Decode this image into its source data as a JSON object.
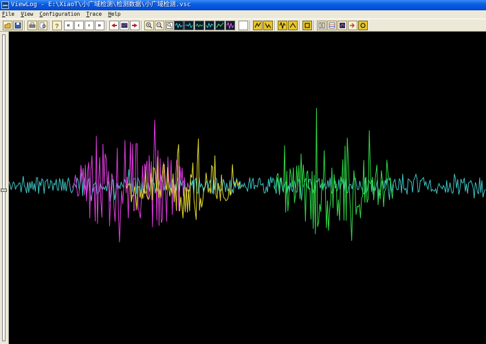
{
  "window": {
    "title": "ViewLog - E:\\XiaoT\\小广域检测\\检测数据\\小广域检测.vsc"
  },
  "menu": {
    "items": [
      "File",
      "View",
      "Configuration",
      "Trace",
      "Help"
    ]
  },
  "toolbar": {
    "nav_first": "«",
    "nav_prev": "‹",
    "nav_next": "›",
    "nav_last": "»"
  },
  "traces": [
    {
      "color": "#3fc7c7",
      "start": 0,
      "end": 694,
      "amplitude": 12
    },
    {
      "color": "#e13ce1",
      "start": 92,
      "end": 262,
      "amplitude": 75
    },
    {
      "color": "#e5d933",
      "start": 170,
      "end": 338,
      "amplitude": 40
    },
    {
      "color": "#2fdc45",
      "start": 385,
      "end": 560,
      "amplitude": 70
    }
  ]
}
